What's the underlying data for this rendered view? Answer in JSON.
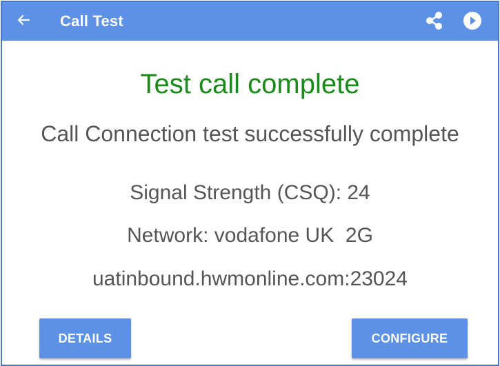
{
  "toolbar": {
    "title": "Call Test",
    "back_icon": "arrow-left-icon",
    "share_icon": "share-icon",
    "play_icon": "play-circle-icon"
  },
  "main": {
    "heading": "Test call complete",
    "subheading": "Call Connection test successfully complete",
    "signal_strength": "Signal Strength (CSQ): 24",
    "network": "Network: vodafone UK  2G",
    "server": "uatinbound.hwmonline.com:23024"
  },
  "buttons": {
    "details_label": "DETAILS",
    "configure_label": "CONFIGURE"
  },
  "colors": {
    "toolbar": "#5d91e6",
    "success_text": "#1a8a1a",
    "body_text": "#555555",
    "button": "#5d91e6",
    "frame_border": "#4a78c4"
  }
}
